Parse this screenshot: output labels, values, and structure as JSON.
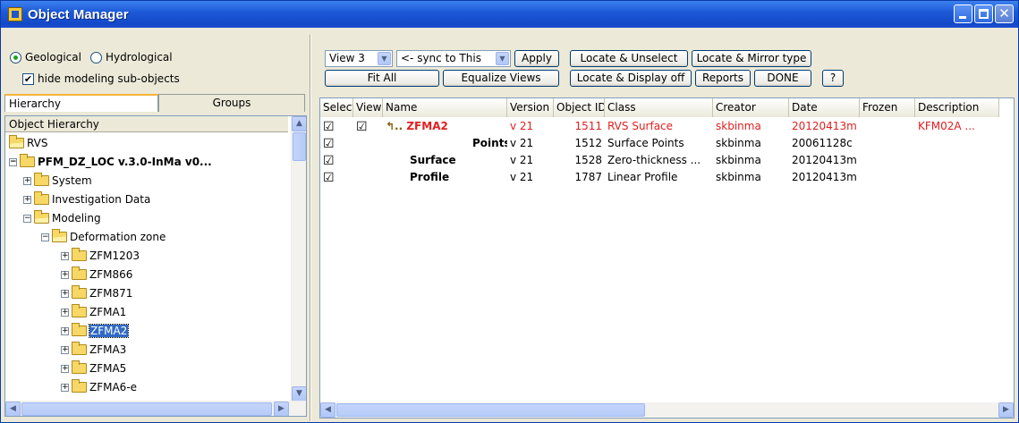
{
  "window": {
    "title": "Object Manager",
    "icon": "app-icon"
  },
  "left": {
    "radio_geo": "Geological",
    "radio_hydro": "Hydrological",
    "geo_selected": true,
    "hide_label": "hide modeling sub-objects",
    "hide_checked": true,
    "tabs": [
      "Hierarchy",
      "Groups"
    ],
    "tree_header": "Object Hierarchy",
    "tree": [
      {
        "label": "RVS"
      },
      {
        "label": "PFM_DZ_LOC v.3.0-InMa v0..."
      },
      {
        "label": "System"
      },
      {
        "label": "Investigation Data"
      },
      {
        "label": "Modeling"
      },
      {
        "label": "Deformation zone"
      },
      {
        "label": "ZFM1203"
      },
      {
        "label": "ZFM866"
      },
      {
        "label": "ZFM871"
      },
      {
        "label": "ZFMA1"
      },
      {
        "label": "ZFMA2"
      },
      {
        "label": "ZFMA3"
      },
      {
        "label": "ZFMA5"
      },
      {
        "label": "ZFMA6-e"
      }
    ]
  },
  "toolbar": {
    "view_combo": "View 3",
    "sync_combo": "<- sync to This",
    "apply": "Apply",
    "locate_unselect": "Locate & Unselect",
    "locate_mirror": "Locate & Mirror type",
    "fit_all": "Fit All",
    "equalize": "Equalize Views",
    "locate_display": "Locate & Display off",
    "reports": "Reports",
    "done": "DONE",
    "help": "?"
  },
  "table": {
    "headers": [
      "Select",
      "View",
      "Name",
      "Version",
      "Object ID",
      "Class",
      "Creator",
      "Date",
      "Frozen",
      "Description"
    ],
    "rows": [
      {
        "select": "☑",
        "view": "☑",
        "name": "ZFMA2",
        "version": "v 21",
        "id": "1511",
        "class": "RVS Surface",
        "creator": "skbinma",
        "date": "20120413m",
        "frozen": "",
        "desc": "KFM02A ..."
      },
      {
        "select": "☑",
        "view": "",
        "name": "Points",
        "version": "v 21",
        "id": "1512",
        "class": "Surface Points",
        "creator": "skbinma",
        "date": "20061128c",
        "frozen": "",
        "desc": ""
      },
      {
        "select": "☑",
        "view": "",
        "name": "Surface",
        "version": "v 21",
        "id": "1528",
        "class": "Zero-thickness ...",
        "creator": "skbinma",
        "date": "20120413m",
        "frozen": "",
        "desc": ""
      },
      {
        "select": "☑",
        "view": "",
        "name": "Profile",
        "version": "v 21",
        "id": "1787",
        "class": "Linear Profile",
        "creator": "skbinma",
        "date": "20120413m",
        "frozen": "",
        "desc": ""
      }
    ]
  }
}
